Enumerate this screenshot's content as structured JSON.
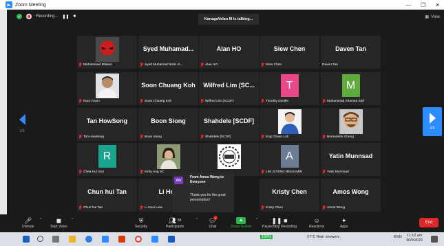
{
  "window": {
    "title": "Zoom Meeting",
    "min": "—",
    "restore": "❐",
    "close": "✕"
  },
  "topbar": {
    "recording": "Recording...",
    "pause": "❚❚",
    "stop": "■",
    "talking": "KanagaVelan M is talking...",
    "view": "View"
  },
  "paging": {
    "left": "2/3",
    "right": "2/3"
  },
  "tiles": [
    {
      "id": "t01",
      "display": "",
      "label": "Muhammad Mislam",
      "kind": "photo-red",
      "muted": true
    },
    {
      "id": "t02",
      "display": "Syed Muhamad...",
      "label": "Syed Muhamad Nizar Al...",
      "kind": "name",
      "muted": true
    },
    {
      "id": "t03",
      "display": "Alan HO",
      "label": "Alan HO",
      "kind": "name",
      "muted": true
    },
    {
      "id": "t04",
      "display": "Siew Chen",
      "label": "Siew Chen",
      "kind": "name",
      "muted": true
    },
    {
      "id": "t05",
      "display": "Daven Tan",
      "label": "Daven Tan",
      "kind": "name",
      "muted": false
    },
    {
      "id": "t06",
      "display": "",
      "label": "Noor Azam",
      "kind": "photo-man",
      "muted": true
    },
    {
      "id": "t07",
      "display": "Soon Chuang Koh",
      "label": "Soon Chuang Koh",
      "kind": "name",
      "muted": true
    },
    {
      "id": "t08",
      "display": "Wilfred Lim (SC...",
      "label": "Wilfred Lim (SCDF)",
      "kind": "name",
      "muted": true
    },
    {
      "id": "t09",
      "display": "T",
      "label": "Timothy Donille",
      "kind": "letter",
      "color": "#e8478a",
      "muted": true
    },
    {
      "id": "t10",
      "display": "M",
      "label": "Muhammad Ahamed Saif",
      "kind": "letter",
      "color": "#5eaa3a",
      "muted": true
    },
    {
      "id": "t11",
      "display": "Tan HowSong",
      "label": "Tan HowSong",
      "kind": "name",
      "muted": true
    },
    {
      "id": "t12",
      "display": "Boon Siong",
      "label": "Boon Siong",
      "kind": "name",
      "muted": true
    },
    {
      "id": "t13",
      "display": "Shahdele [SCDF]",
      "label": "Shahdele [SCDF]",
      "kind": "name",
      "muted": true
    },
    {
      "id": "t14",
      "display": "",
      "label": "Eng Choon Loh",
      "kind": "photo-boy",
      "muted": true
    },
    {
      "id": "t15",
      "display": "",
      "label": "Bernadette Cheng",
      "kind": "photo-emoji",
      "muted": true
    },
    {
      "id": "t16",
      "display": "R",
      "label": "Chea Hui Gan",
      "kind": "letter",
      "color": "#1aa38f",
      "muted": true
    },
    {
      "id": "t17",
      "display": "",
      "label": "Kirby Ang SC",
      "kind": "photo-woman",
      "muted": true
    },
    {
      "id": "t18",
      "display": "",
      "label": "",
      "kind": "photo-logo",
      "muted": false
    },
    {
      "id": "t19",
      "display": "A",
      "label": "LIM JI FENG BENJAMIN",
      "kind": "letter",
      "color": "#6b7c93",
      "muted": true
    },
    {
      "id": "t20",
      "display": "Yatin Munnsad",
      "label": "Yatin Munnsad",
      "kind": "name",
      "muted": true
    },
    {
      "id": "t21",
      "display": "Chun hui Tan",
      "label": "Chun hui Tan",
      "kind": "name",
      "muted": true
    },
    {
      "id": "t22",
      "display": "Li Hoo",
      "label": "Li Hooi Liew",
      "kind": "name",
      "muted": true
    },
    {
      "id": "t23",
      "display": "",
      "label": "",
      "kind": "blank",
      "muted": false
    },
    {
      "id": "t24",
      "display": "Kristy Chen",
      "label": "Kristy Chen",
      "kind": "name",
      "muted": true
    },
    {
      "id": "t25",
      "display": "Amos Wong",
      "label": "Amos Wong",
      "kind": "name",
      "muted": true
    }
  ],
  "chat_popup": {
    "initials": "AW",
    "from": "From Amos Wong to Everyone",
    "message": "Thank you for the great presentation!"
  },
  "toolbar": {
    "unmute": "Unmute",
    "start_video": "Start Video",
    "security": "Security",
    "participants": "Participants",
    "participants_count": "55",
    "chat": "Chat",
    "chat_badge": "1",
    "share_screen": "Share Screen",
    "recording": "Pause/Stop Recording",
    "reactions": "Reactions",
    "apps": "Apps",
    "end": "End"
  },
  "taskbar": {
    "weather": "27°C  Rain showers",
    "lang": "ENG",
    "time": "11:12 am",
    "date": "30/9/2021",
    "battery": "100%"
  }
}
